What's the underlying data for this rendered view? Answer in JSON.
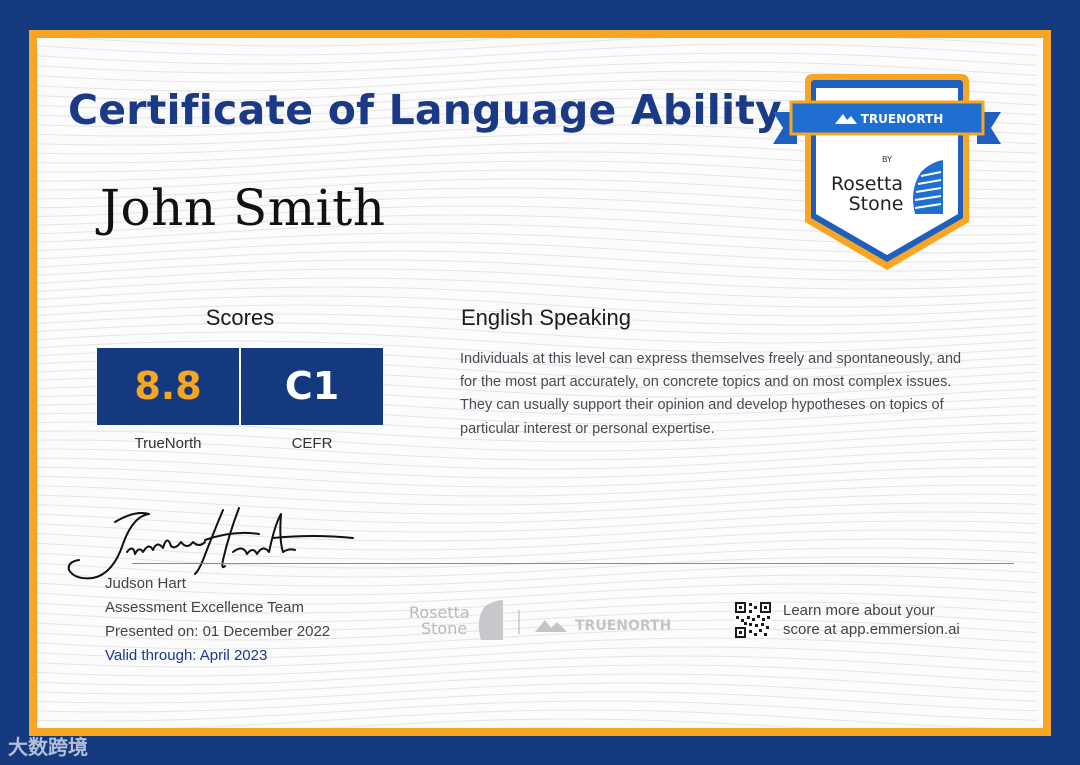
{
  "certificate": {
    "title": "Certificate of Language Ability",
    "recipient": "John Smith"
  },
  "badge": {
    "top_brand": "TRUENORTH",
    "by": "BY",
    "brand_line1": "Rosetta",
    "brand_line2": "Stone"
  },
  "scores": {
    "heading": "Scores",
    "items": [
      {
        "value": "8.8",
        "label": "TrueNorth"
      },
      {
        "value": "C1",
        "label": "CEFR"
      }
    ]
  },
  "skill": {
    "title": "English Speaking",
    "description": "Individuals at this level can express themselves freely and spontaneously, and for the most part accurately, on concrete topics and on most complex issues. They can usually support their opinion and develop hypotheses on topics of particular interest or personal expertise."
  },
  "signatory": {
    "name": "Judson Hart",
    "team": "Assessment Excellence Team",
    "presented": "Presented on: 01 December 2022",
    "valid": "Valid through: April 2023"
  },
  "footer": {
    "logo1_line1": "Rosetta",
    "logo1_line2": "Stone",
    "logo2": "TRUENORTH",
    "learn_line1": "Learn more about your",
    "learn_line2": "score at app.emmersion.ai"
  },
  "watermark": "大数跨境",
  "colors": {
    "navy": "#14397f",
    "orange": "#f6a623",
    "badge_blue": "#1f6fd1"
  }
}
